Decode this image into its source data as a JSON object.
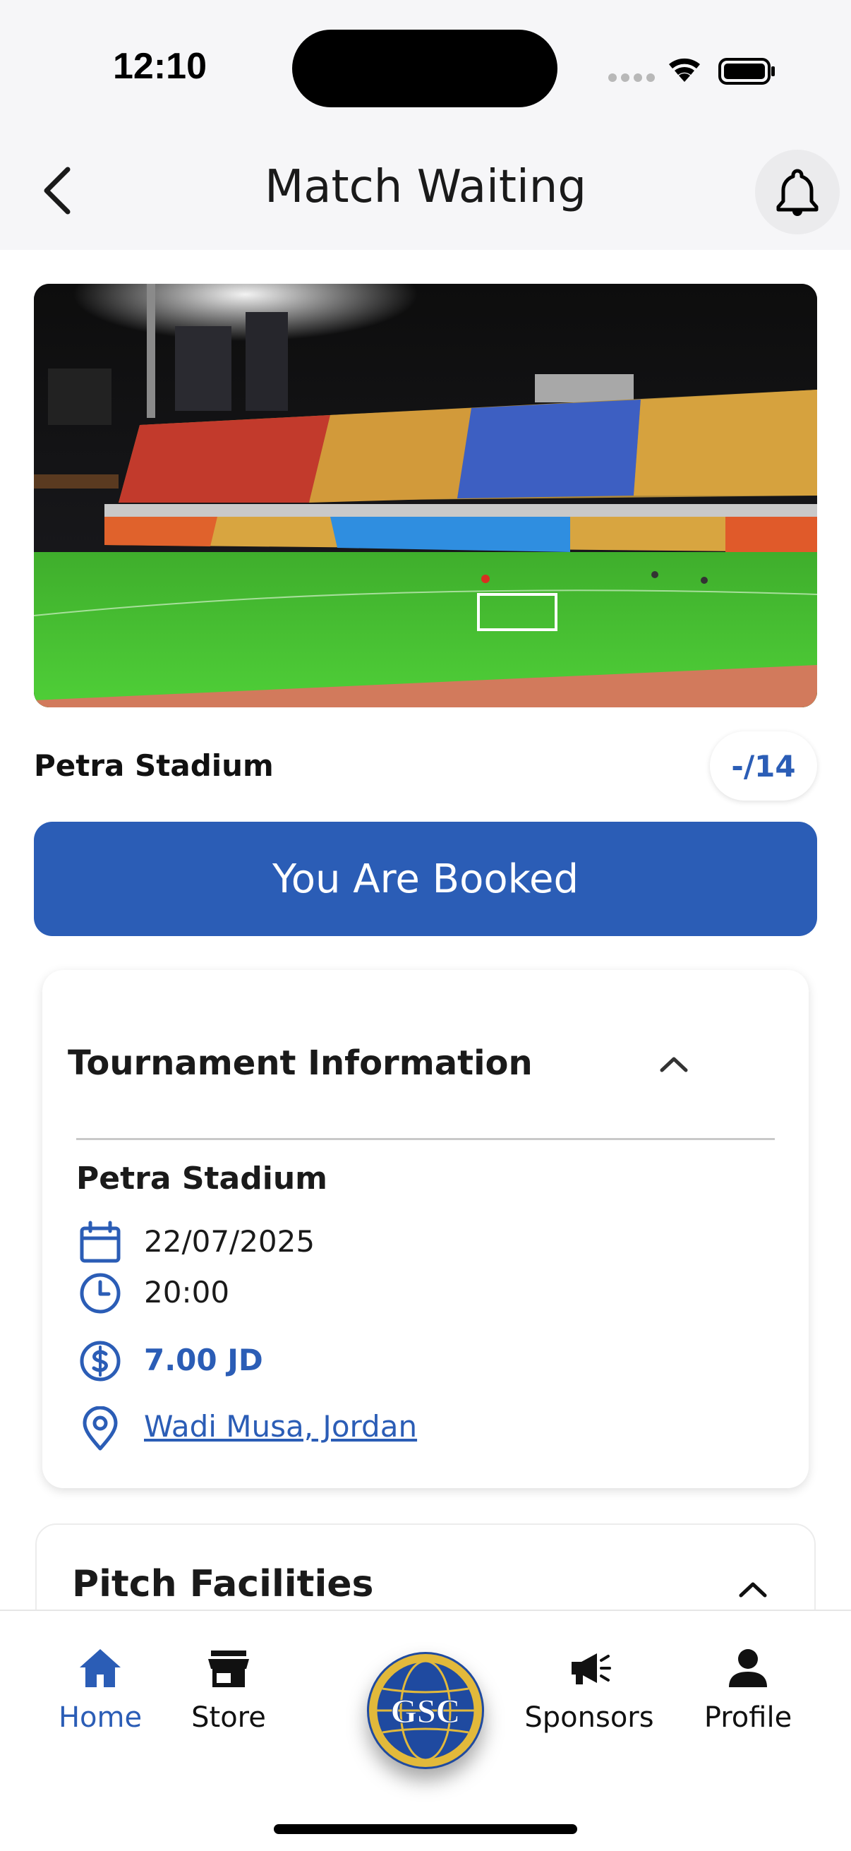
{
  "status_bar": {
    "time": "12:10"
  },
  "header": {
    "title": "Match Waiting"
  },
  "venue": {
    "name": "Petra Stadium",
    "capacity": "-/14"
  },
  "booking": {
    "status_label": "You Are Booked"
  },
  "tournament": {
    "section_title": "Tournament Information",
    "stadium": "Petra Stadium",
    "date": "22/07/2025",
    "time": "20:00",
    "price": "7.00 JD",
    "location": "Wadi Musa, Jordan"
  },
  "facilities": {
    "section_title": "Pitch Facilities"
  },
  "bottom_nav": {
    "items": [
      {
        "label": "Home",
        "icon": "home-icon"
      },
      {
        "label": "Store",
        "icon": "store-icon"
      },
      {
        "label": "Sponsors",
        "icon": "megaphone-icon"
      },
      {
        "label": "Profile",
        "icon": "person-icon"
      }
    ],
    "center_logo_text": "GSC"
  },
  "colors": {
    "accent": "#2b5db6",
    "text": "#1a1a1a",
    "topbar_bg": "#f6f6f8",
    "logo_gold": "#e2b93b"
  }
}
